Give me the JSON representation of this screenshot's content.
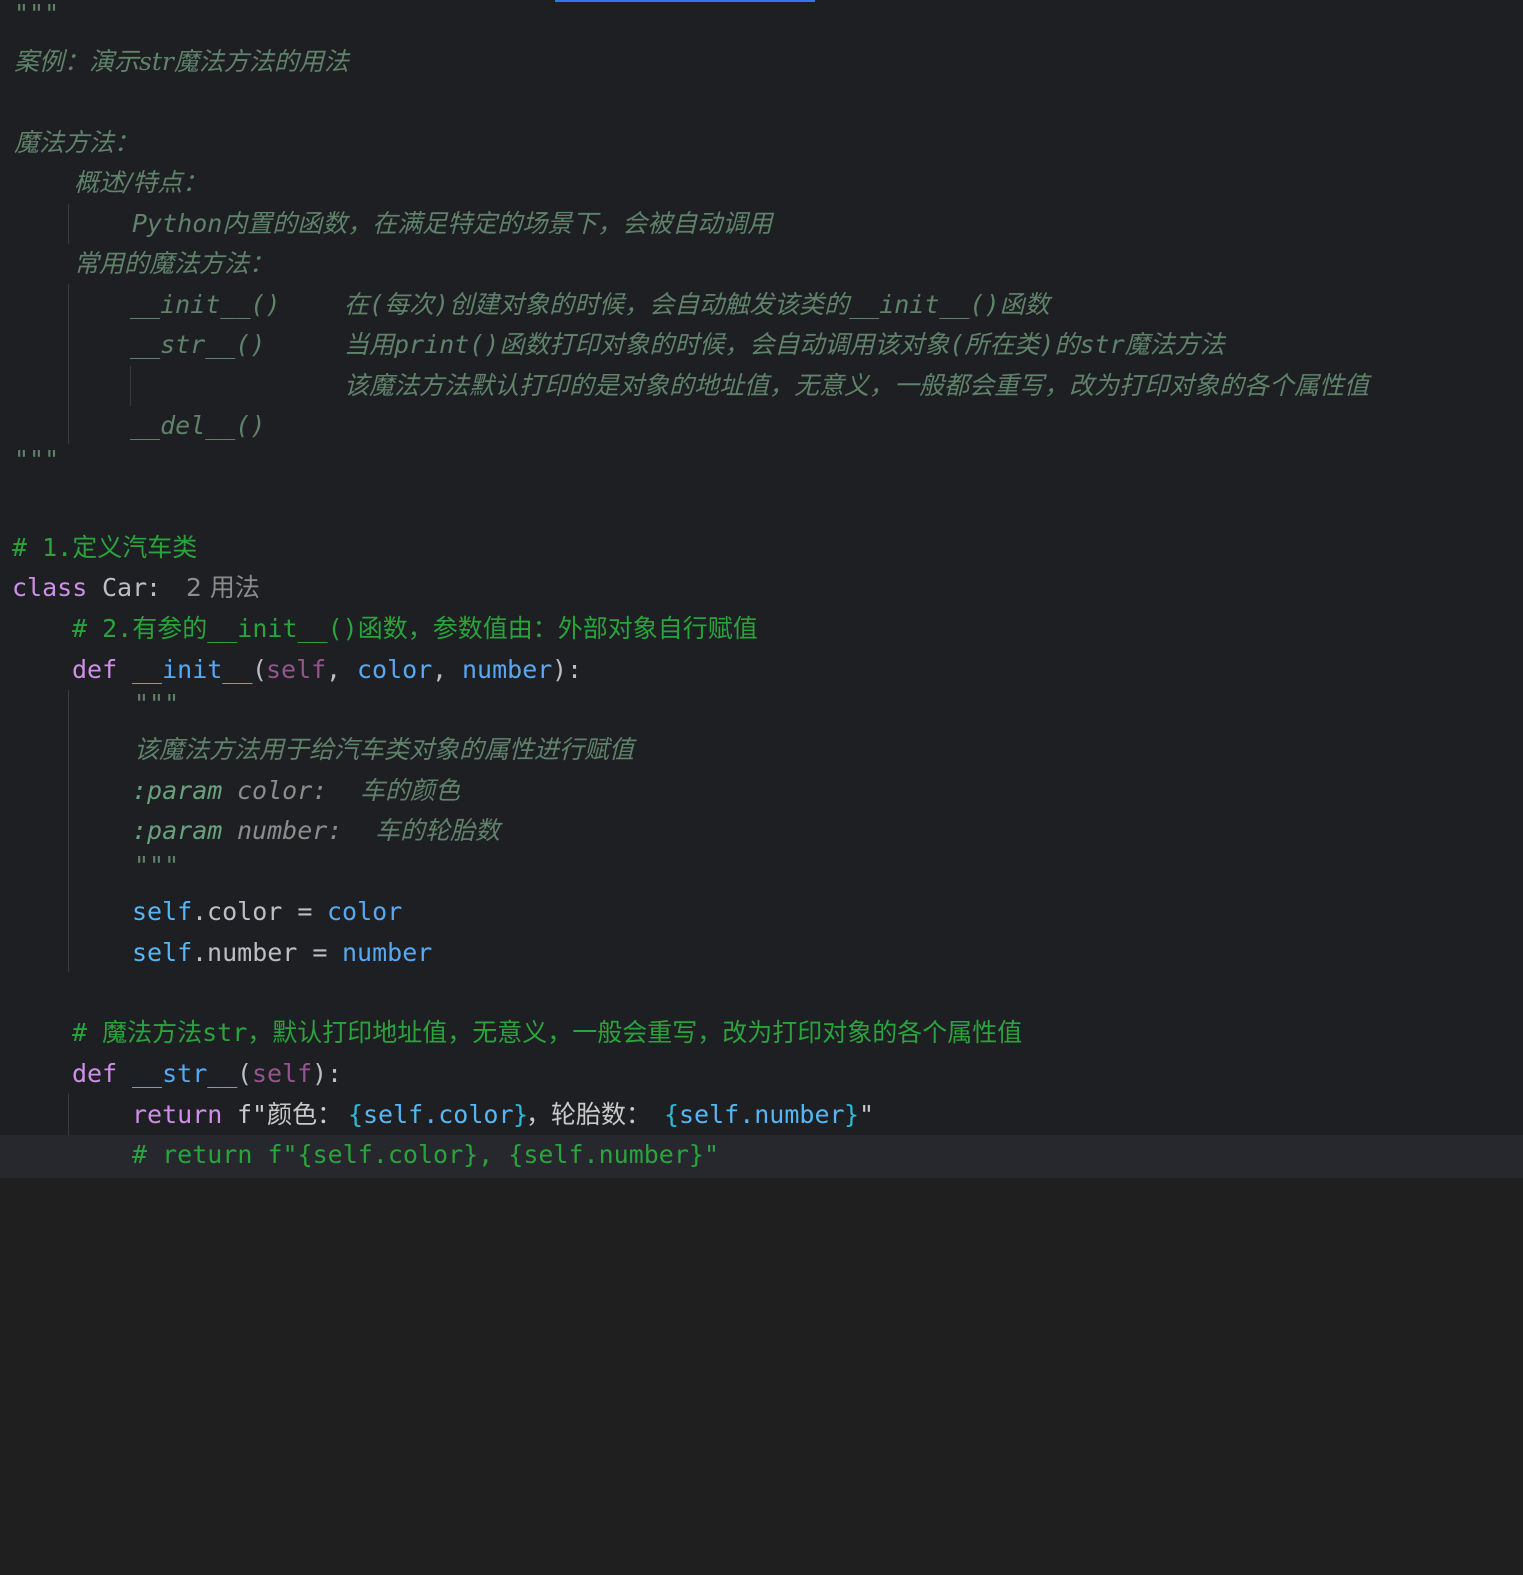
{
  "docstring": {
    "open": "\"\"\"",
    "title": "案例：演示str魔法方法的用法",
    "section1": "魔法方法：",
    "overview_label": "概述/特点：",
    "overview_text": "Python内置的函数，在满足特定的场景下，会被自动调用",
    "common_label": "常用的魔法方法：",
    "methods": [
      {
        "name": "__init__()",
        "desc": "在(每次)创建对象的时候，会自动触发该类的__init__()函数"
      },
      {
        "name": "__str__()",
        "desc": "当用print()函数打印对象的时候，会自动调用该对象(所在类)的str魔法方法"
      },
      {
        "name": "",
        "desc": "该魔法方法默认打印的是对象的地址值，无意义，一般都会重写，改为打印对象的各个属性值"
      },
      {
        "name": "__del__()",
        "desc": ""
      }
    ],
    "close": "\"\"\""
  },
  "code": {
    "comment1": "# 1.定义汽车类",
    "class_kw": "class",
    "class_name": "Car",
    "class_colon": ":",
    "usage_hint": "2 用法",
    "comment2": "# 2.有参的__init__()函数，参数值由：外部对象自行赋值",
    "def_kw": "def",
    "init_name": "__init__",
    "init_params_open": "(",
    "init_self": "self",
    "init_comma1": ", ",
    "init_color": "color",
    "init_comma2": ", ",
    "init_number": "number",
    "init_params_close": "):",
    "init_doc_open": "\"\"\"",
    "init_doc_text": "该魔法方法用于给汽车类对象的属性进行赋值",
    "param_tag": ":param",
    "param_color_name": "color:",
    "param_color_desc": "车的颜色",
    "param_number_name": "number:",
    "param_number_desc": "车的轮胎数",
    "init_doc_close": "\"\"\"",
    "assign1_self": "self",
    "assign1_attr": ".color = ",
    "assign1_val": "color",
    "assign2_self": "self",
    "assign2_attr": ".number = ",
    "assign2_val": "number",
    "comment3": "# 魔法方法str，默认打印地址值，无意义，一般会重写，改为打印对象的各个属性值",
    "str_name": "__str__",
    "str_params_open": "(",
    "str_self": "self",
    "str_params_close": "):",
    "return_kw": "return",
    "fstr_prefix": "f\"颜色：",
    "fstr_brace1": "{",
    "fstr_self1": "self.color",
    "fstr_brace1c": "}",
    "fstr_mid": "，轮胎数：",
    "fstr_brace2": "{",
    "fstr_self2": "self.number",
    "fstr_brace2c": "}",
    "fstr_end": "\"",
    "comment4": "# return f\"{self.color}, {self.number}\""
  },
  "colors": {
    "background": "#1e1f22",
    "docstring": "#5f826b",
    "comment": "#2aa33d",
    "keyword": "#cf8ee8",
    "param": "#56a8f5"
  }
}
